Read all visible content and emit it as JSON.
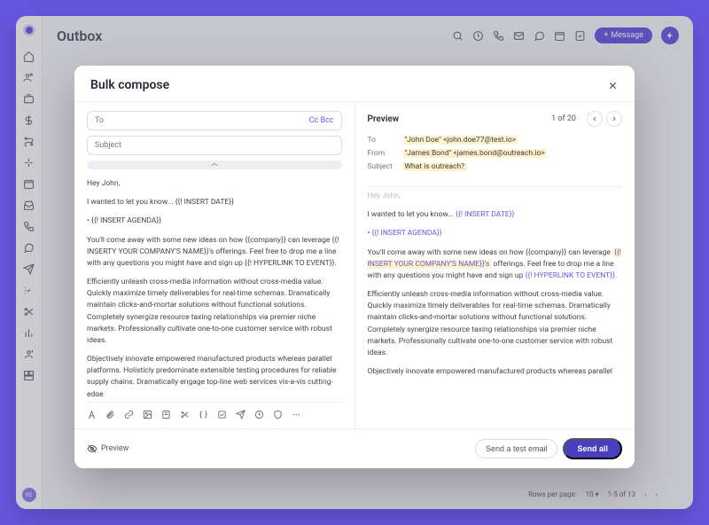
{
  "header": {
    "title": "Outbox",
    "message_btn": "Message",
    "avatar_initials": "RS"
  },
  "modal": {
    "title": "Bulk compose",
    "to_label": "To",
    "cc": "Cc",
    "bcc": "Bcc",
    "subject_label": "Subject",
    "preview_btn": "Preview",
    "send_test": "Send a test email",
    "send_all": "Send all"
  },
  "editor": {
    "p1": "Hey John,",
    "p2": "I wanted to let you know... {{! INSERT DATE}}",
    "p3": "• {{! INSERT AGENDA}}",
    "p4": "You'll come away with some new ideas on how {{company}} can leverage {{! INSERTY YOUR COMPANY'S NAME}}'s offerings. Feel free to drop me a line with any questions you might have and sign up {{! HYPERLINK TO EVENT}}.",
    "p5": "Efficiently unleash cross-media information without cross-media value. Quickly maximize timely deliverables for real-time schemas. Dramatically maintain clicks-and-mortar solutions without functional solutions. Completely synergize resource taxing relationships via premier niche markets. Professionally cultivate one-to-one customer service with robust ideas.",
    "p6": "Objectively innovate empowered manufactured products whereas parallel platforms. Holisticly predominate extensible testing procedures for reliable supply chains. Dramatically engage top-line web services vis-a-vis cutting-edge"
  },
  "preview": {
    "title": "Preview",
    "counter": "1 of 20",
    "to_label": "To",
    "to_value": "\"John Doe\" <john.doe77@test.io>",
    "from_label": "From",
    "from_value": "\"James Bond\" <james.bond@outreach.io>",
    "subject_label": "Subject",
    "subject_value": "What is outreach?",
    "p_cut": "Hey John,",
    "p1a": "I wanted to let you know... ",
    "p1b": "{{! INSERT DATE}}",
    "p2a": "• ",
    "p2b": "{{! INSERT AGENDA}}",
    "p3a": "You'll come away with some new ideas on how {{company}} can leverage ",
    "p3b": "{{! INSERT YOUR COMPANY'S NAME}}'s",
    "p3c": " offerings. Feel free to drop me a line with any questions you might have and sign up ",
    "p3d": "{{! HYPERLINK TO EVENT}}",
    "p3e": ".",
    "p4": "Efficiently unleash cross-media information without cross-media value. Quickly maximize timely deliverables for real-time schemas. Dramatically maintain clicks-and-mortar solutions without functional solutions. Completely synergize resource taxing relationships via premier niche markets. Professionally cultivate one-to-one customer service with robust ideas.",
    "p5": "Objectively innovate empowered manufactured products whereas parallel platforms. Holisticly predominate extensible testing procedures for reliable supply chains. Dramatically engage top-line web services vis-a-vis cutting-edge deliverables. Proactively envisioned multimedia based"
  },
  "pager": {
    "rows_label": "Rows per page:",
    "rows_value": "10",
    "range": "1-5 of 13"
  }
}
